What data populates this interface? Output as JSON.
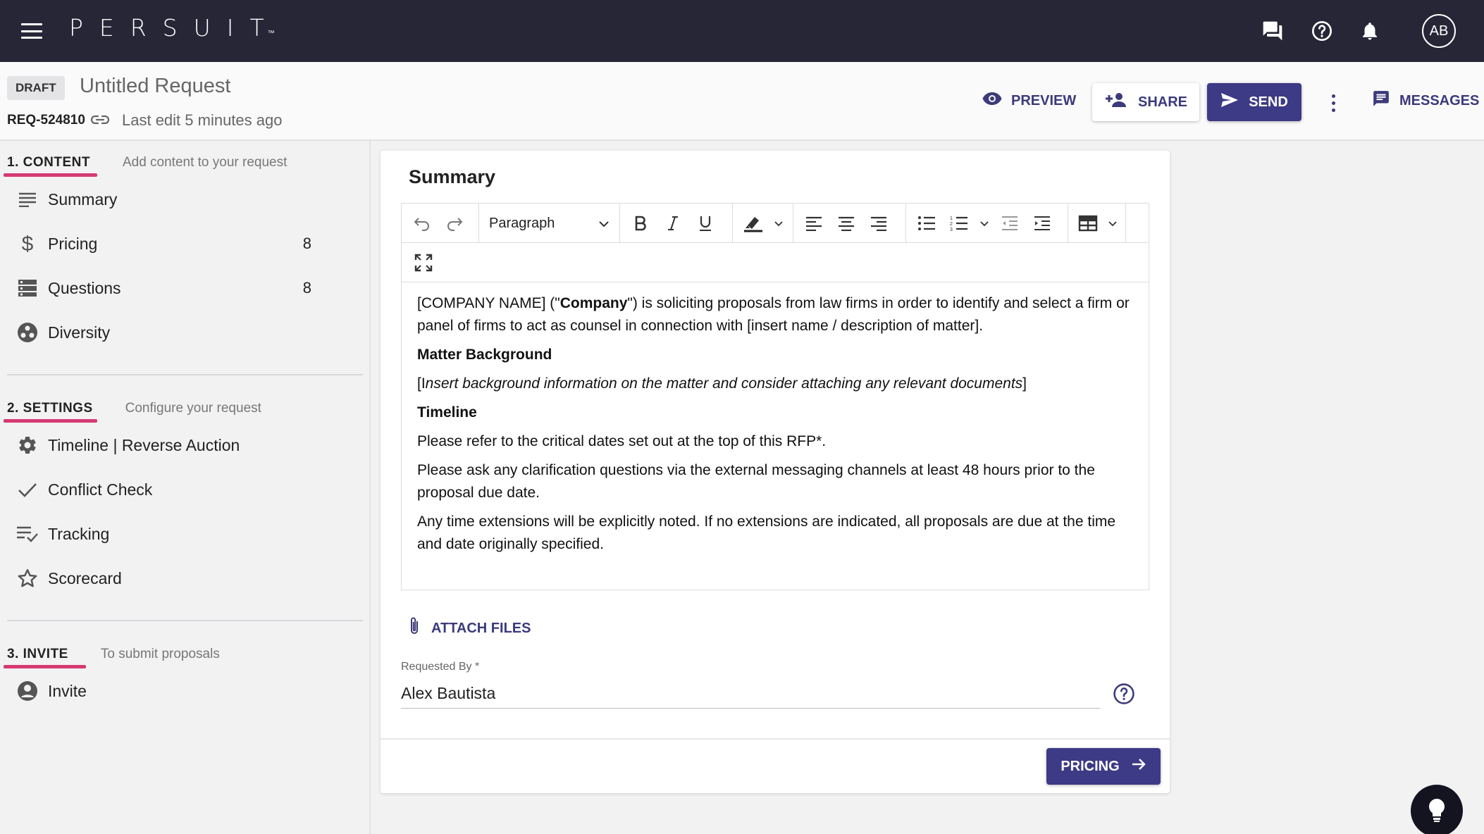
{
  "topbar": {
    "logo": "PERSUIT",
    "logo_tm": "™",
    "avatar_initials": "AB"
  },
  "header": {
    "status_badge": "DRAFT",
    "title": "Untitled Request",
    "request_id": "REQ-524810",
    "last_edit": "Last edit 5 minutes ago",
    "preview_label": "PREVIEW",
    "share_label": "SHARE",
    "send_label": "SEND",
    "messages_label": "MESSAGES"
  },
  "sidebar": {
    "content": {
      "title": "1. CONTENT",
      "description": "Add content to your request",
      "items": [
        {
          "label": "Summary",
          "icon": "summary-lines-icon",
          "count": ""
        },
        {
          "label": "Pricing",
          "icon": "dollar-icon",
          "count": "8"
        },
        {
          "label": "Questions",
          "icon": "questions-list-icon",
          "count": "8"
        },
        {
          "label": "Diversity",
          "icon": "diversity-icon",
          "count": ""
        }
      ]
    },
    "settings": {
      "title": "2. SETTINGS",
      "description": "Configure your request",
      "items": [
        {
          "label": "Timeline | Reverse Auction",
          "icon": "gear-icon"
        },
        {
          "label": "Conflict Check",
          "icon": "check-icon"
        },
        {
          "label": "Tracking",
          "icon": "tracking-list-icon"
        },
        {
          "label": "Scorecard",
          "icon": "star-icon"
        }
      ]
    },
    "invite": {
      "title": "3. INVITE",
      "description": "To submit proposals",
      "items": [
        {
          "label": "Invite",
          "icon": "account-circle-icon"
        }
      ]
    }
  },
  "main": {
    "card_title": "Summary",
    "toolbar": {
      "block_format": "Paragraph"
    },
    "body": {
      "p1_a": "[COMPANY NAME] (\"",
      "p1_bold": "Company",
      "p1_b": "\") is soliciting proposals from law firms in order to identify and select a firm or panel of firms to act as counsel in connection with [insert name / description of matter].",
      "h_matter": "Matter Background",
      "p2_a": "[I",
      "p2_italic": "nsert background information on the matter and consider attaching any relevant documents",
      "p2_b": "]",
      "h_timeline": "Timeline",
      "p3": "Please refer to the critical dates set out at the top of this RFP*.",
      "p4": "Please ask any clarification questions via the external messaging channels at least 48 hours prior to the proposal due date.",
      "p5": "Any time extensions will be explicitly noted. If no extensions are indicated, all proposals are due at the time and date originally specified."
    },
    "attach_label": "ATTACH FILES",
    "requested_by_label": "Requested By *",
    "requested_by_value": "Alex Bautista",
    "next_button_label": "PRICING"
  },
  "colors": {
    "topbar_bg": "#262637",
    "accent": "#3d3a86",
    "section_underline": "#d63a72"
  }
}
